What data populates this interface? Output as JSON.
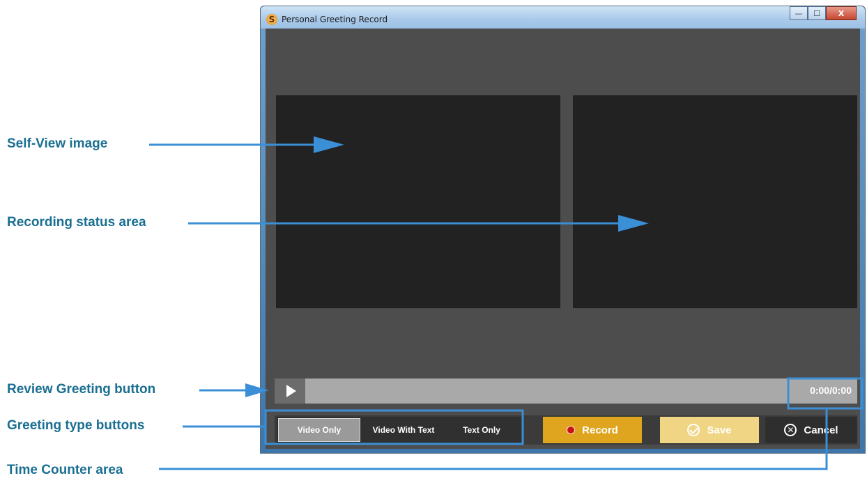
{
  "callouts": {
    "self_view": "Self-View image",
    "recording_status": "Recording status area",
    "review_greeting": "Review Greeting button",
    "greeting_type": "Greeting type buttons",
    "time_counter": "Time Counter area"
  },
  "window": {
    "title": "Personal Greeting Record",
    "app_icon_letter": "S",
    "minimize_symbol": "—",
    "maximize_symbol": "☐",
    "close_symbol": "X"
  },
  "player": {
    "time_counter": "0:00/0:00"
  },
  "greeting_types": [
    "Video Only",
    "Video With Text",
    "Text Only"
  ],
  "selected_greeting_type": "Video Only",
  "actions": {
    "record_label": "Record",
    "save_label": "Save",
    "cancel_label": "Cancel"
  },
  "colors": {
    "callout_text": "#1a6f92",
    "callout_arrow": "#3a8fd6",
    "record_button": "#e0a51f",
    "save_button_disabled": "#f0d584"
  },
  "icons": {
    "play": "play-icon",
    "record": "record-dot-icon",
    "save": "check-circle-icon",
    "cancel": "x-circle-icon"
  }
}
